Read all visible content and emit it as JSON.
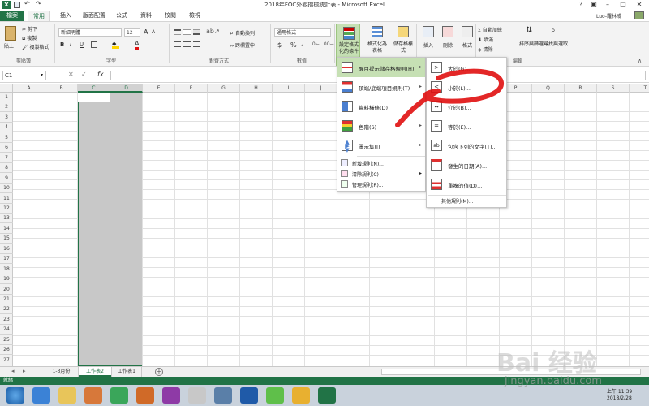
{
  "window": {
    "title": "2018年FOC外觀擋檢統計表 - Microsoft Excel",
    "user": "Luo-羅林成"
  },
  "quick_access": {
    "save_icon": "save-icon",
    "undo_icon": "undo-icon",
    "redo_icon": "redo-icon"
  },
  "tabs": [
    {
      "label": "檔案"
    },
    {
      "label": "常用"
    },
    {
      "label": "插入"
    },
    {
      "label": "版面配置"
    },
    {
      "label": "公式"
    },
    {
      "label": "資料"
    },
    {
      "label": "校閱"
    },
    {
      "label": "檢視"
    }
  ],
  "ribbon": {
    "clipboard": {
      "paste": "貼上",
      "cut": "剪下",
      "copy": "複製",
      "format_painter": "複製格式",
      "group": "剪貼簿"
    },
    "font": {
      "name": "新細明體",
      "size": "12",
      "bold": "B",
      "italic": "I",
      "underline": "U",
      "group": "字型",
      "font_color_glyph": "A",
      "grow_glyph": "A",
      "shrink_glyph": "A"
    },
    "alignment": {
      "wrap": "自動換列",
      "merge": "跨欄置中",
      "group": "對齊方式"
    },
    "number": {
      "format": "通用格式",
      "currency": "$",
      "percent": "%",
      "comma": ",",
      "group": "數值"
    },
    "styles": {
      "conditional": "設定格式化的條件",
      "table": "格式化為表格",
      "cell": "儲存格樣式"
    },
    "cells": {
      "insert": "插入",
      "delete": "刪除",
      "format": "格式"
    },
    "editing": {
      "autosum": "自動加總",
      "fill": "填滿",
      "clear": "清除",
      "sort": "排序與篩選",
      "find": "尋找與選取",
      "group": "編輯"
    }
  },
  "formula_bar": {
    "name_box": "C1",
    "fx": "fx",
    "cancel_glyph": "✕",
    "enter_glyph": "✓"
  },
  "columns": [
    "A",
    "B",
    "C",
    "D",
    "E",
    "F",
    "G",
    "H",
    "I",
    "J",
    "K",
    "L",
    "M",
    "N",
    "O",
    "P",
    "Q",
    "R",
    "S",
    "T"
  ],
  "rows": [
    "1",
    "2",
    "3",
    "4",
    "5",
    "6",
    "7",
    "8",
    "9",
    "10",
    "11",
    "12",
    "13",
    "14",
    "15",
    "16",
    "17",
    "18",
    "19",
    "20",
    "21",
    "22",
    "23",
    "24",
    "25",
    "26",
    "27"
  ],
  "sheets": [
    {
      "label": "1-3月份"
    },
    {
      "label": "工作表2"
    },
    {
      "label": "工作表1"
    }
  ],
  "status": {
    "text": "就緒"
  },
  "cf_menu": {
    "items": [
      {
        "label": "醒目提示儲存格規則(H)"
      },
      {
        "label": "頂端/底端項目規則(T)"
      },
      {
        "label": "資料橫條(D)"
      },
      {
        "label": "色階(S)"
      },
      {
        "label": "圖示集(I)"
      },
      {
        "label": "新增規則(N)..."
      },
      {
        "label": "清除規則(C)"
      },
      {
        "label": "管理規則(R)..."
      }
    ]
  },
  "sub_menu": {
    "items": [
      {
        "label": "大於(G)..."
      },
      {
        "label": "小於(L)..."
      },
      {
        "label": "介於(B)..."
      },
      {
        "label": "等於(E)..."
      },
      {
        "label": "包含下列的文字(T)..."
      },
      {
        "label": "發生的日期(A)..."
      },
      {
        "label": "重複的值(D)..."
      }
    ],
    "more": "其他規則(M)..."
  },
  "clock": {
    "time": "上午 11:39",
    "date": "2018/2/28"
  },
  "watermark": {
    "text": "jingyan.baidu.com"
  },
  "colors": {
    "excel_green": "#217346",
    "highlight_green": "#c6e0b4",
    "selection_gray": "#c8c8c8",
    "annotation_red": "#e01010"
  }
}
